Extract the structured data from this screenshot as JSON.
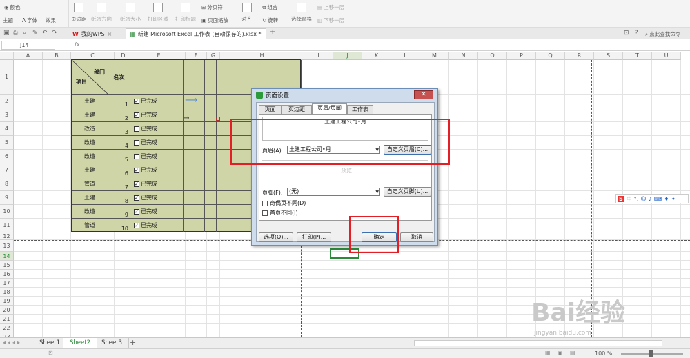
{
  "ribbon": {
    "group1": {
      "theme": "主题",
      "colors": "颜色",
      "fonts": "字体",
      "effects": "效果"
    },
    "margin": "页边距",
    "orientation": "纸张方向",
    "size": "纸张大小",
    "print_area": "打印区域",
    "print_title": "打印标题",
    "page_break": "分页符",
    "page_zoom": "页面缩放",
    "align": "对齐",
    "group": "组合",
    "rotate": "旋转",
    "selection_pane": "选择窗格",
    "bring_forward": "上移一层",
    "send_backward": "下移一层"
  },
  "tabs": {
    "wps": "我的WPS",
    "doc": "新建 Microsoft Excel 工作表 (自动保存的).xlsx *",
    "add": "+",
    "search": "点此查找命令"
  },
  "formula": {
    "cell": "J14",
    "fx": "fx"
  },
  "columns": [
    "A",
    "B",
    "C",
    "D",
    "E",
    "F",
    "G",
    "H",
    "I",
    "J",
    "K",
    "L",
    "M",
    "N",
    "O",
    "P",
    "Q",
    "R",
    "S",
    "T",
    "U"
  ],
  "rows": [
    "1",
    "2",
    "3",
    "4",
    "5",
    "6",
    "7",
    "8",
    "9",
    "10",
    "11",
    "12",
    "13",
    "14",
    "15",
    "16",
    "17",
    "18",
    "19",
    "20",
    "21",
    "22",
    "23"
  ],
  "table": {
    "header_dept": "部门",
    "header_item": "项目",
    "header_rank": "名次",
    "done_label": "已完成",
    "records": [
      {
        "item": "土建",
        "rank": "1",
        "checked": true
      },
      {
        "item": "土建",
        "rank": "2",
        "checked": true
      },
      {
        "item": "改造",
        "rank": "3",
        "checked": false
      },
      {
        "item": "改造",
        "rank": "4",
        "checked": false
      },
      {
        "item": "改造",
        "rank": "5",
        "checked": false
      },
      {
        "item": "土建",
        "rank": "6",
        "checked": true
      },
      {
        "item": "管道",
        "rank": "7",
        "checked": true
      },
      {
        "item": "土建",
        "rank": "8",
        "checked": true
      },
      {
        "item": "改造",
        "rank": "9",
        "checked": true
      },
      {
        "item": "管道",
        "rank": "10",
        "checked": true
      }
    ]
  },
  "dialog": {
    "title": "页面设置",
    "tabs": [
      "页面",
      "页边距",
      "页眉/页脚",
      "工作表"
    ],
    "active_tab": "页眉/页脚",
    "header_preview": "土建工程公司•月",
    "header_label": "页眉(A):",
    "header_value": "土建工程公司•月",
    "custom_header": "自定义页眉(C)...",
    "preview_label": "预览",
    "footer_label": "页脚(F):",
    "footer_value": "(无)",
    "custom_footer": "自定义页脚(U)...",
    "odd_even": "奇偶页不同(D)",
    "first_page": "首页不同(I)",
    "options": "选项(O)...",
    "print": "打印(P)...",
    "ok": "确定",
    "cancel": "取消"
  },
  "sheets": [
    "Sheet1",
    "Sheet2",
    "Sheet3"
  ],
  "active_sheet": "Sheet2",
  "status": {
    "zoom": "100 %"
  },
  "ime": {
    "label": "中"
  },
  "watermark": {
    "brand": "Bai经验",
    "url": "jingyan.baidu.com"
  },
  "colors": {
    "accent_red": "#e31e24",
    "table_fill": "#cfd5a6",
    "active_green": "#2a8a3a"
  }
}
